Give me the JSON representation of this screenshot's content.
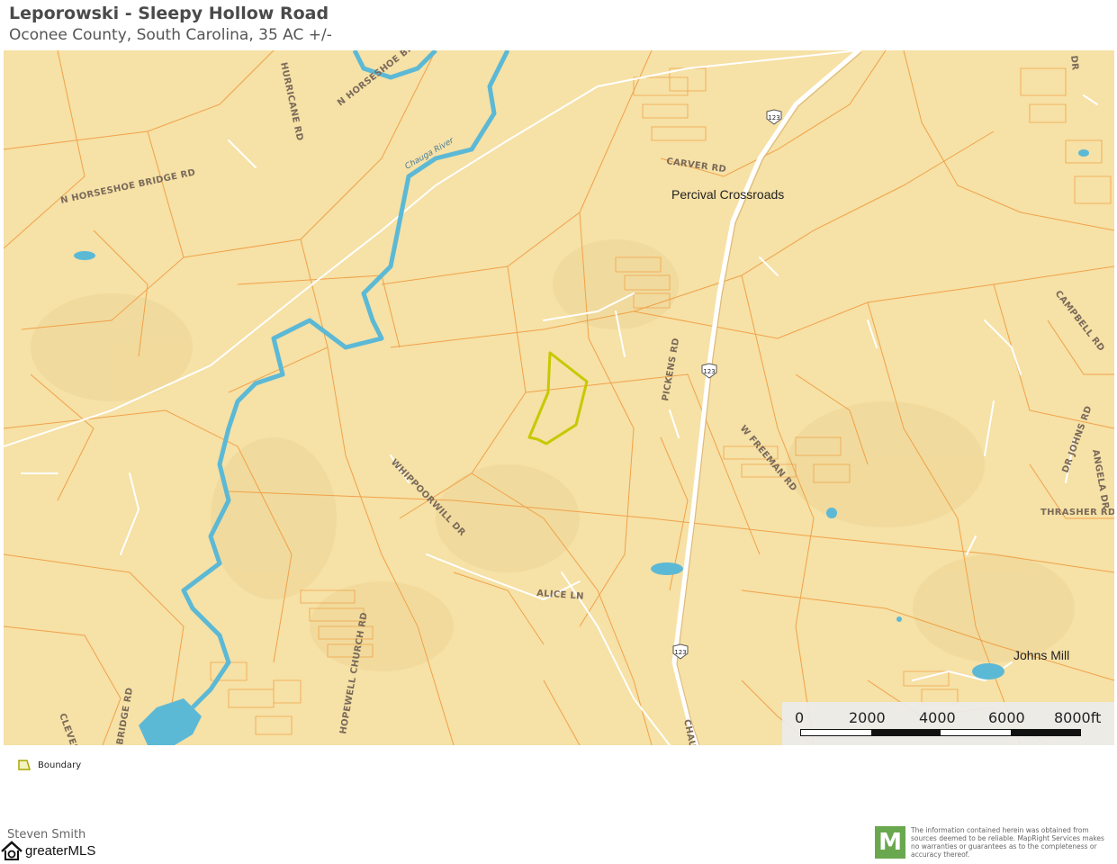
{
  "header": {
    "title": "Leporowski - Sleepy Hollow Road",
    "subtitle": "Oconee County, South Carolina, 35 AC +/-"
  },
  "map": {
    "places": [
      "Percival Crossroads",
      "Johns Mill"
    ],
    "roads": [
      "N HORSESHOE BRIDGE RD",
      "N HORSESHOE BRIDGE",
      "HURRICANE RD",
      "CARVER RD",
      "CAMPBELL RD",
      "PICKENS RD",
      "W FREEMAN RD",
      "WHIPPOORWILL DR",
      "ALICE LN",
      "HOPEWELL CHURCH RD",
      "CLEVELAND",
      "BRIDGE RD",
      "DR JOHNS RD",
      "ANGELA DR",
      "THRASHER RD",
      "CHAUGA",
      "DR"
    ],
    "highway_shields": [
      "123",
      "123",
      "123"
    ],
    "river_label": "Chauga River",
    "colors": {
      "land": "#f6e1a6",
      "parcel_lines": "#f0a24a",
      "water": "#5cb9d6",
      "boundary": "#c8c800",
      "roads": "#ffffff"
    }
  },
  "scale": {
    "ticks": [
      "0",
      "2000",
      "4000",
      "6000",
      "8000ft"
    ]
  },
  "legend": {
    "label": "Boundary",
    "icon": "boundary-polygon-icon"
  },
  "footer": {
    "agent_name": "Steven Smith",
    "mls_logo_text": "greaterMLS",
    "mls_icon": "house-icon",
    "mapright_letter": "M",
    "disclaimer": "The information contained herein was obtained from sources deemed to be reliable. MapRight Services makes no warranties or guarantees as to the completeness or accuracy thereof."
  }
}
